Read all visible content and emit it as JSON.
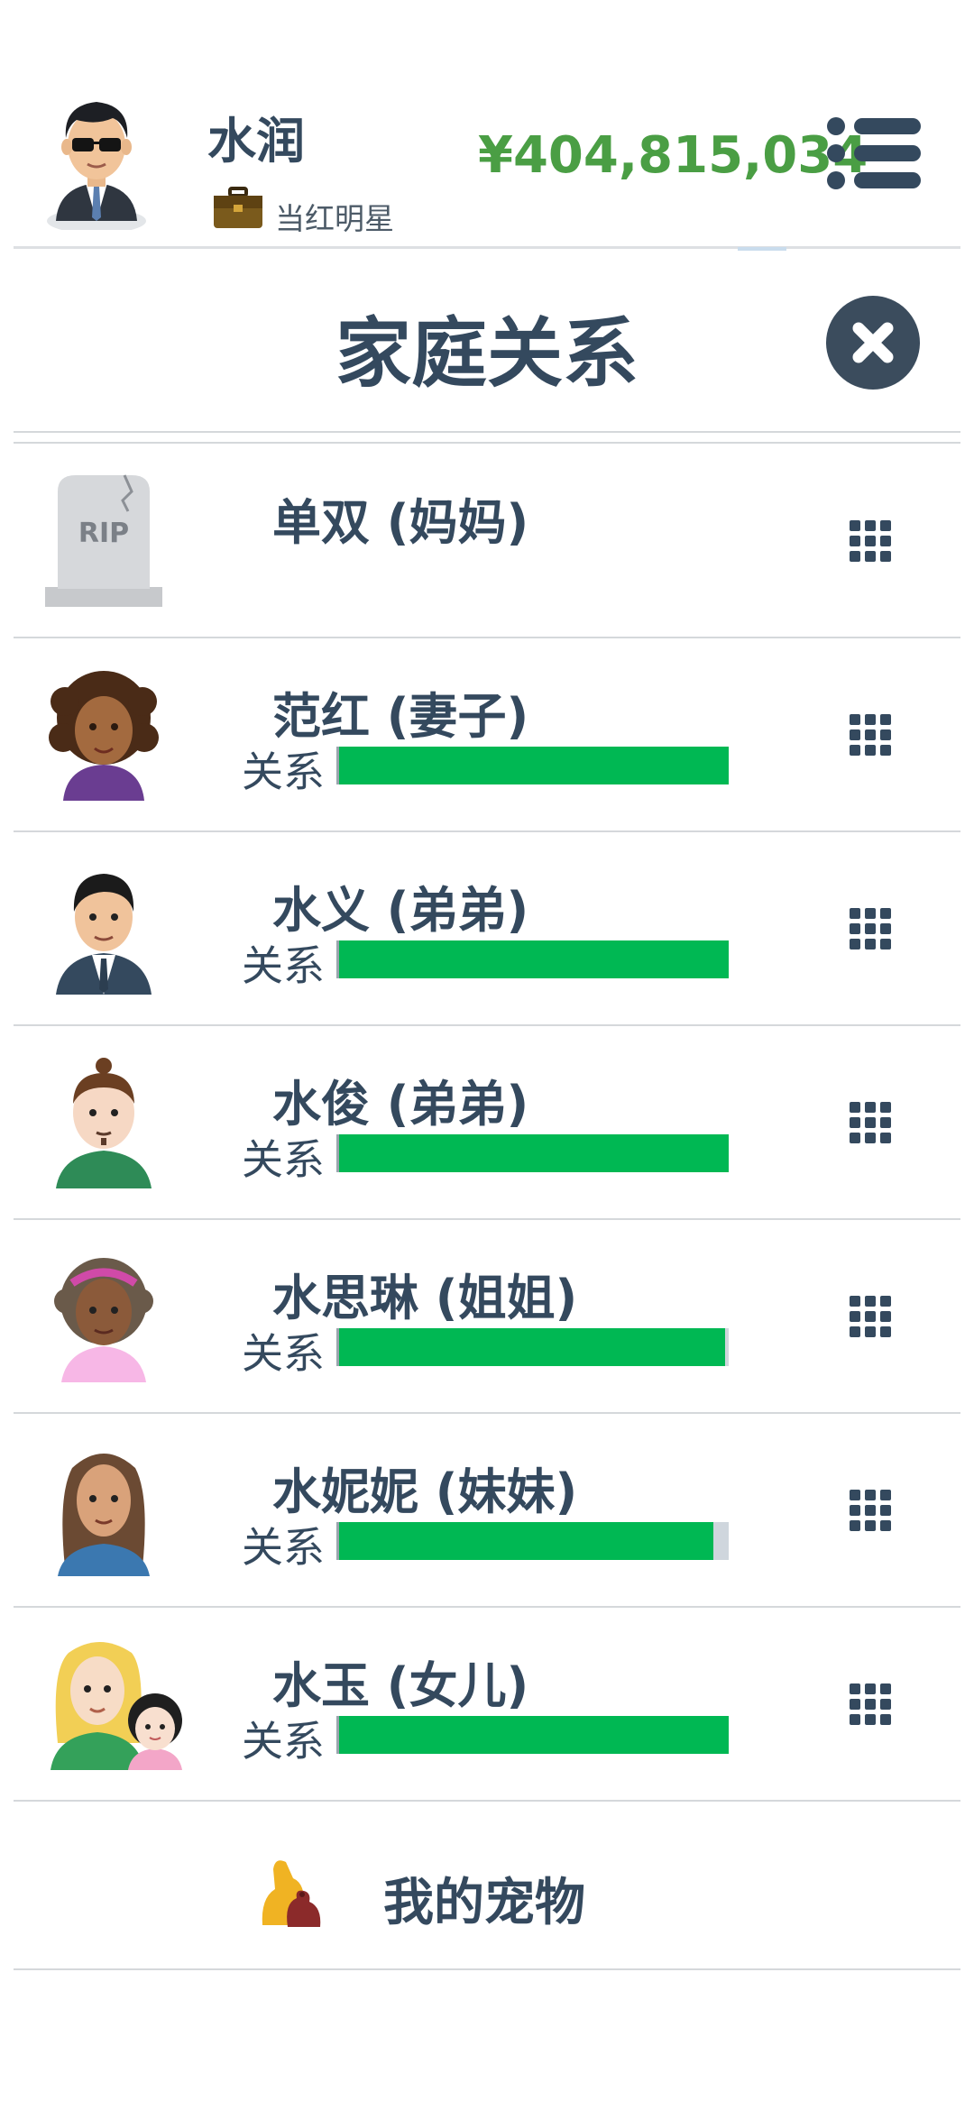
{
  "header": {
    "player_name": "水润",
    "job_title": "当红明星",
    "money": "¥404,815,034",
    "avatar_icon": "player-avatar-icon",
    "job_icon": "briefcase-icon",
    "menu_icon": "menu-icon"
  },
  "page": {
    "title": "家庭关系",
    "close_icon": "close-icon"
  },
  "relation_label": "关系",
  "family": [
    {
      "name": "单双 (妈妈)",
      "status": "deceased",
      "avatar": "tombstone-icon",
      "relationship": null
    },
    {
      "name": "范红 (妻子)",
      "avatar": "wife-avatar-icon",
      "relationship": 1.0
    },
    {
      "name": "水义 (弟弟)",
      "avatar": "brother-avatar-icon",
      "relationship": 1.0
    },
    {
      "name": "水俊 (弟弟)",
      "avatar": "brother-avatar-icon",
      "relationship": 1.0
    },
    {
      "name": "水思琳 (姐姐)",
      "avatar": "sister-avatar-icon",
      "relationship": 0.99
    },
    {
      "name": "水妮妮 (妹妹)",
      "avatar": "sister-avatar-icon",
      "relationship": 0.96
    },
    {
      "name": "水玉 (女儿)",
      "avatar": "daughter-avatar-icon",
      "relationship": 1.0
    }
  ],
  "tombstone_text": "RIP",
  "pets": {
    "label": "我的宠物",
    "icon": "pet-dog-icon"
  },
  "colors": {
    "text": "#34495e",
    "money": "#4a9e44",
    "bar_fill": "#00b853",
    "bar_track": "#cfd6dd",
    "close_bg": "#3b4c5d"
  }
}
